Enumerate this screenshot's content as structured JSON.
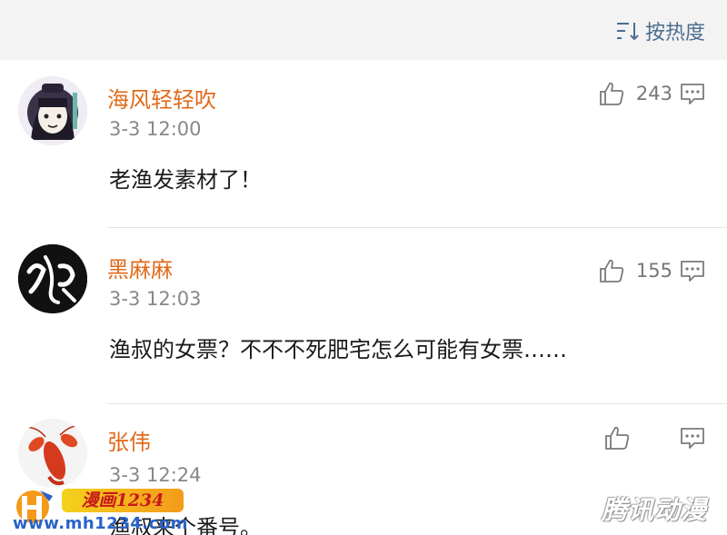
{
  "header": {
    "sort_label": "按热度"
  },
  "comments": [
    {
      "name": "海风轻轻吹",
      "time": "3-3   12:00",
      "text": "老渔发素材了！",
      "likes": "243"
    },
    {
      "name": "黑麻麻",
      "time": "3-3   12:03",
      "text": "渔叔的女票？不不不死肥宅怎么可能有女票……",
      "likes": "155"
    },
    {
      "name": "张伟",
      "time": "3-3   12:24",
      "text": "渔叔来个番号。",
      "likes": ""
    }
  ],
  "watermark": {
    "left_badge": "漫画1234",
    "left_url": "www.mh1234.com",
    "right_text": "腾讯动漫"
  },
  "icons": {
    "sort": "sort-lines-icon",
    "like": "thumbs-up-icon",
    "reply": "comment-bubble-icon"
  },
  "colors": {
    "name": "#e06a1b",
    "sort": "#4b6d8e",
    "time": "#888888",
    "icon": "#7a7a7a"
  }
}
